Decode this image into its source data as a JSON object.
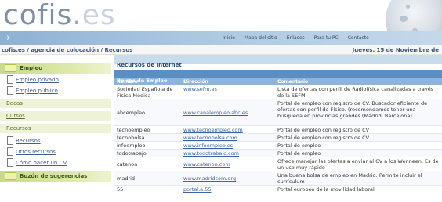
{
  "header": {
    "logo_main": "cofis",
    "logo_dot": ".",
    "logo_tld": "es"
  },
  "topnav": [
    "Inicio",
    "Mapa del sitio",
    "Enlaces",
    "Para tu PC",
    "Contacto"
  ],
  "breadcrumb": "cofis.es / agencia de colocación / Recursos",
  "date": "Jueves, 15 de Noviembre de",
  "sidebar": {
    "items": [
      {
        "label": "Empleo",
        "kind": "head"
      },
      {
        "label": "Empleo privado",
        "kind": "doc"
      },
      {
        "label": "Empleo público",
        "kind": "doc"
      },
      {
        "label": "Becas",
        "kind": "green"
      },
      {
        "label": "Cursos",
        "kind": "green"
      },
      {
        "label": "Recursos",
        "kind": "green"
      },
      {
        "label": "Recursos",
        "kind": "doc"
      },
      {
        "label": "Otros recursos",
        "kind": "doc"
      },
      {
        "label": "Cómo hacer un CV",
        "kind": "doc"
      },
      {
        "label": "Buzón de sugerencias",
        "kind": "head"
      }
    ]
  },
  "main": {
    "title": "Recursos de Internet",
    "table_caption": "Bolsas de Empleo",
    "columns": [
      "Nombre",
      "Dirección",
      "Comentario"
    ],
    "rows": [
      [
        "Sociedad Española de Física Médica",
        "www.sefm.es",
        "Lista de ofertas con perfil de Radiofísica canalizadas a través de la SEFM"
      ],
      [
        "abcempleo",
        "www.canalempleo.abc.es",
        "Portal de empleo con registro de CV. Buscador eficiente de ofertas con perfil de Físico. (recomendamos tener una búsqueda en provincias grandes (Madrid, Barcelona)"
      ],
      [
        "tecnoempleo",
        "www.tecnoempleo.com",
        "Portal de empleo con registro de CV"
      ],
      [
        "tecnobolsa",
        "www.tecnobolsa.com",
        "Portal de empleo con registro de CV"
      ],
      [
        "infoempleo",
        "www.infoempleo.es",
        "Portal de empleo"
      ],
      [
        "todotrabajo",
        "www.todotrabajo.com",
        "Portal de empleo"
      ],
      [
        "catenon",
        "www.catenon.com",
        "Ofrece manejar las ofertas a enviar al CV a los Wenneen. Es de un uso muy rápido"
      ],
      [
        "madrid",
        "www.madridcom.org",
        "Una buena bolsa de empleo en Madrid. Permite incluir el currículum"
      ],
      [
        "55",
        "portal.a.55",
        "Portal europeo de la movilidad laboral"
      ]
    ]
  }
}
